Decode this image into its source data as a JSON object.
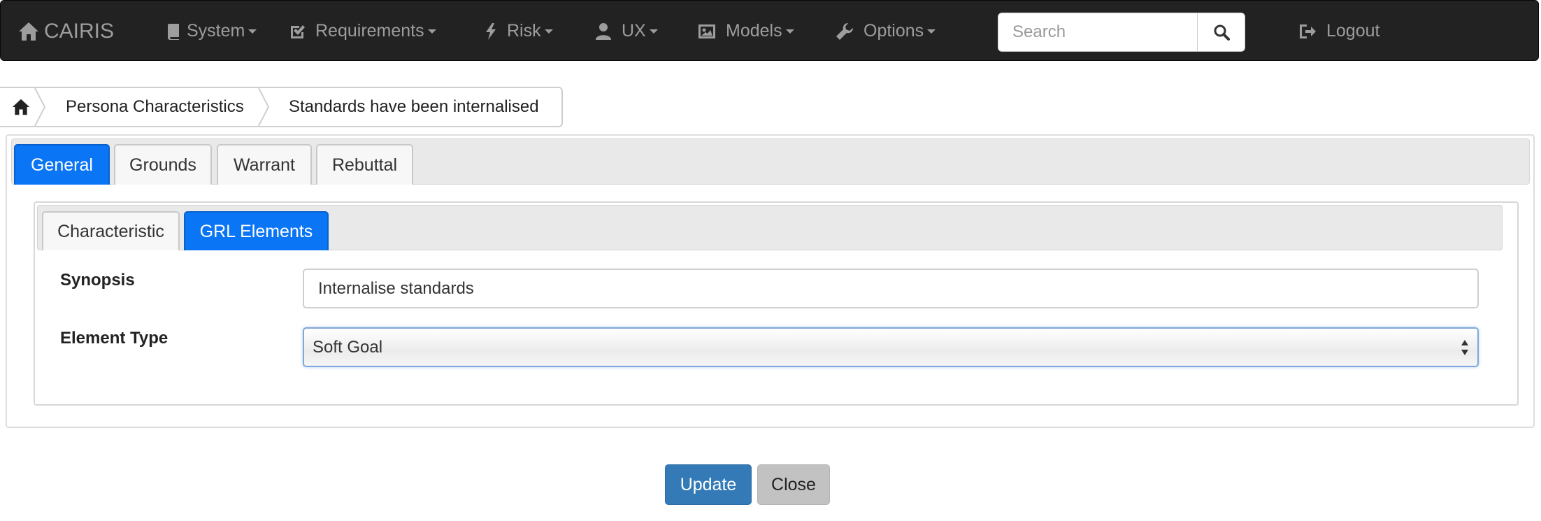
{
  "navbar": {
    "brand": "CAIRIS",
    "menus": [
      {
        "label": "System",
        "icon": "book-icon"
      },
      {
        "label": "Requirements",
        "icon": "check-square-icon"
      },
      {
        "label": "Risk",
        "icon": "bolt-icon"
      },
      {
        "label": "UX",
        "icon": "user-icon"
      },
      {
        "label": "Models",
        "icon": "picture-icon"
      },
      {
        "label": "Options",
        "icon": "wrench-icon"
      }
    ],
    "search_placeholder": "Search",
    "logout_label": "Logout"
  },
  "breadcrumb": {
    "items": [
      "Persona Characteristics",
      "Standards have been internalised"
    ]
  },
  "outer_tabs": [
    {
      "label": "General",
      "active": true
    },
    {
      "label": "Grounds",
      "active": false
    },
    {
      "label": "Warrant",
      "active": false
    },
    {
      "label": "Rebuttal",
      "active": false
    }
  ],
  "inner_tabs": [
    {
      "label": "Characteristic",
      "active": false
    },
    {
      "label": "GRL Elements",
      "active": true
    }
  ],
  "form": {
    "synopsis_label": "Synopsis",
    "synopsis_value": "Internalise standards",
    "element_type_label": "Element Type",
    "element_type_value": "Soft Goal"
  },
  "buttons": {
    "update": "Update",
    "close": "Close"
  },
  "colors": {
    "navbar_bg": "#222222",
    "active_tab": "#0a75f5",
    "update_button": "#337ab7",
    "close_button": "#c2c2c2"
  }
}
